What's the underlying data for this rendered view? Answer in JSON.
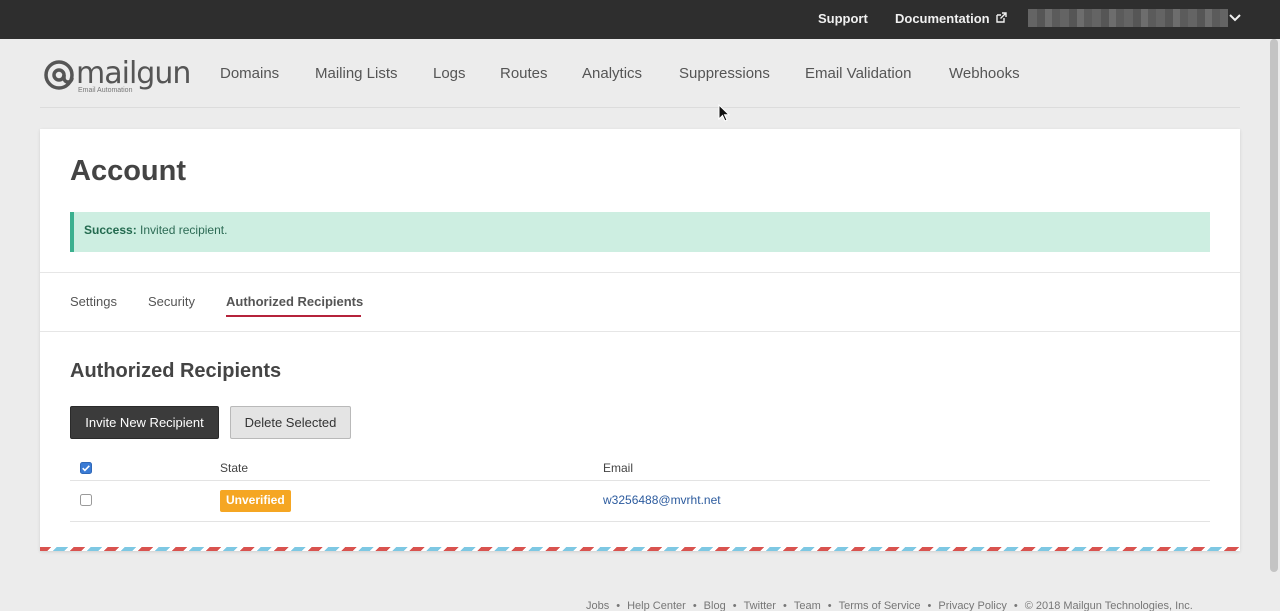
{
  "topbar": {
    "support": "Support",
    "documentation": "Documentation"
  },
  "logo": {
    "word": "mailgun",
    "tagline": "Email Automation"
  },
  "nav": {
    "items": [
      "Domains",
      "Mailing Lists",
      "Logs",
      "Routes",
      "Analytics",
      "Suppressions",
      "Email Validation",
      "Webhooks"
    ]
  },
  "page": {
    "title": "Account",
    "alert_strong": "Success:",
    "alert_text": " Invited recipient."
  },
  "tabs": [
    "Settings",
    "Security",
    "Authorized Recipients"
  ],
  "section": {
    "title": "Authorized Recipients",
    "invite_button": "Invite New Recipient",
    "delete_button": "Delete Selected"
  },
  "table": {
    "headers": [
      "State",
      "Email"
    ],
    "rows": [
      {
        "state": "Unverified",
        "email": "w3256488@mvrht.net"
      }
    ]
  },
  "footer": {
    "links": [
      "Jobs",
      "Help Center",
      "Blog",
      "Twitter",
      "Team",
      "Terms of Service",
      "Privacy Policy"
    ],
    "copyright": "© 2018 Mailgun Technologies, Inc."
  },
  "colors": {
    "topbar": "#2e2e2e",
    "accent_tab": "#b5233b",
    "badge": "#f5a623",
    "alert_bg": "#cdeee1",
    "link": "#2c5b9e"
  }
}
